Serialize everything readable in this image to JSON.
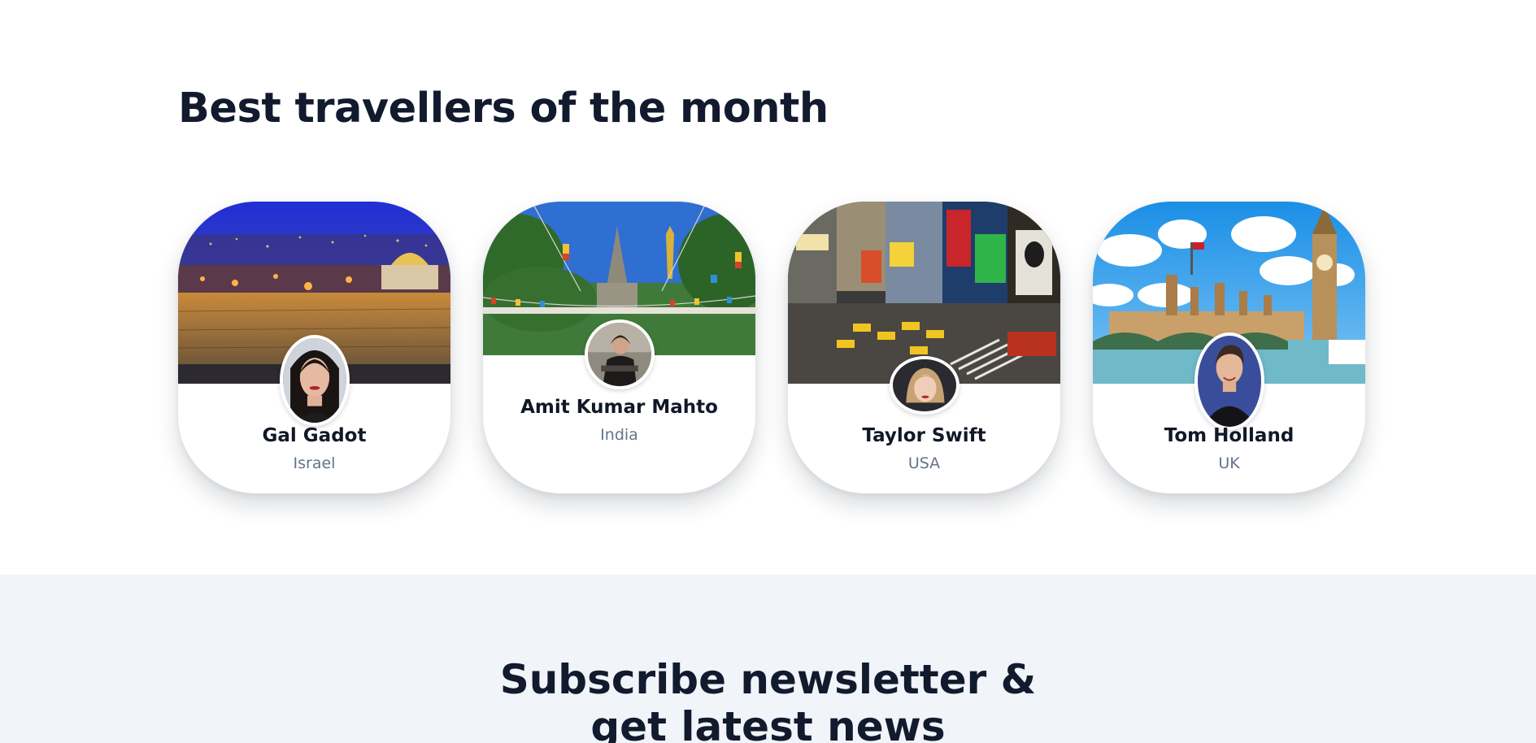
{
  "travellers": {
    "title": "Best travellers of the month",
    "cards": [
      {
        "name": "Gal Gadot",
        "country": "Israel",
        "cover_icon": "jerusalem-night-photo",
        "avatar_icon": "traveller-portrait"
      },
      {
        "name": "Amit Kumar Mahto",
        "country": "India",
        "cover_icon": "temple-photo",
        "avatar_icon": "traveller-portrait"
      },
      {
        "name": "Taylor Swift",
        "country": "USA",
        "cover_icon": "times-square-photo",
        "avatar_icon": "traveller-portrait"
      },
      {
        "name": "Tom Holland",
        "country": "UK",
        "cover_icon": "westminster-photo",
        "avatar_icon": "traveller-portrait"
      }
    ]
  },
  "newsletter": {
    "title_line1": "Subscribe newsletter &",
    "title_line2": "get latest news"
  },
  "colors": {
    "heading": "#121a2e",
    "muted": "#64748b",
    "newsletter_bg": "#f1f4f8"
  }
}
